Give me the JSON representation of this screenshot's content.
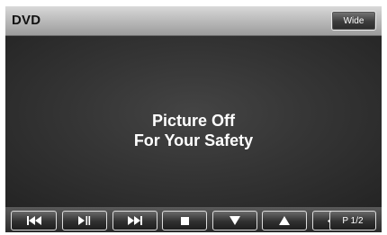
{
  "header": {
    "title": "DVD",
    "wide_button_label": "Wide"
  },
  "main": {
    "message_line1": "Picture Off",
    "message_line2": "For Your Safety"
  },
  "controls": {
    "items": [
      {
        "icon": "previous-track-icon"
      },
      {
        "icon": "play-pause-icon"
      },
      {
        "icon": "next-track-icon"
      },
      {
        "icon": "stop-icon"
      },
      {
        "icon": "down-arrow-icon"
      },
      {
        "icon": "up-arrow-icon"
      },
      {
        "icon": "direction-pad-icon"
      }
    ],
    "page_label": "P 1/2"
  },
  "colors": {
    "screen_background": "#151515",
    "title_bar": "#bdbdbd",
    "button_border": "#dcdcdc",
    "text": "#ffffff"
  }
}
